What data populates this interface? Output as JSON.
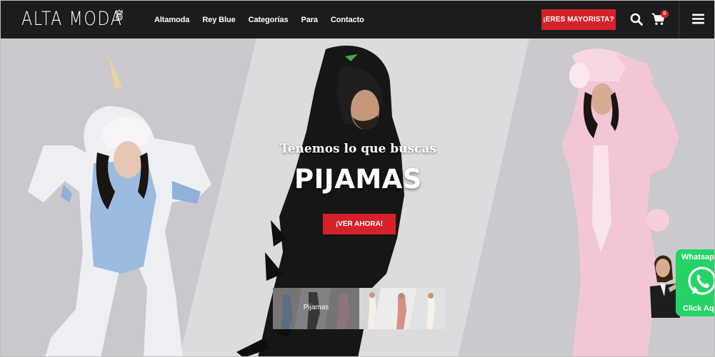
{
  "header": {
    "logo_text": "ALTA MODA",
    "nav": [
      "Altamoda",
      "Rey Blue",
      "Categorías",
      "Para",
      "Contacto"
    ],
    "mayorista_label": "¡ERES MAYORISTA?",
    "cart_count": "0"
  },
  "hero": {
    "subtitle": "Tenemos lo que buscas",
    "title": "PIJAMAS",
    "cta_label": "¡VER AHORA!",
    "thumbnails": [
      {
        "label": "Pijamas"
      },
      {
        "label": ""
      }
    ]
  },
  "whatsapp": {
    "top_label": "Whatsapp",
    "bottom_label": "Click Aqui"
  },
  "colors": {
    "navbar": "#1c1c1c",
    "accent_red": "#d5222a",
    "whatsapp_green": "#25d366"
  }
}
